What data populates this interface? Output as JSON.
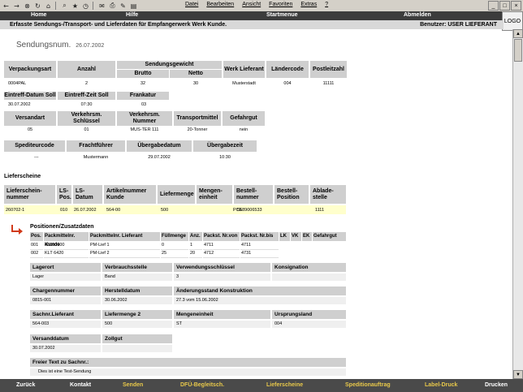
{
  "browser": {
    "menu": [
      "Datei",
      "Bearbeiten",
      "Ansicht",
      "Favoriten",
      "Extras",
      "?"
    ]
  },
  "nav": {
    "home": "Home",
    "help": "Hilfe",
    "start": "Startmenue",
    "logout": "Abmelden"
  },
  "logo": "LOGO",
  "subbar": {
    "title": "Erfasste Sendungs-/Transport- und Lieferdaten für Empfangerwerk Werk Kunde.",
    "user": "Benutzer: USER LIEFERANT"
  },
  "page": {
    "title": "Sendungsnum.",
    "date": "26.07.2002"
  },
  "sendung": {
    "headers": [
      "Verpackungsart",
      "Anzahl",
      "Sendungsgewicht",
      "Brutto",
      "Netto",
      "Werk Lieferant",
      "Ländercode",
      "Postleitzahl"
    ],
    "values": [
      "0004PAL",
      "2",
      "32",
      "30",
      "Musterstadt",
      "004",
      "11111"
    ]
  },
  "eintreff": {
    "headers": [
      "Eintreff-Datum Soll",
      "Eintreff-Zeit Soll",
      "Frankatur"
    ],
    "values": [
      "30.07.2002",
      "07:30",
      "03"
    ]
  },
  "versand": {
    "headers": [
      "Versandart",
      "Verkehrsm. Schlüssel",
      "Verkehrsm. Nummer",
      "Transportmittel",
      "Gefahrgut"
    ],
    "values": [
      "05",
      "01",
      "MUS-TER 111",
      "20-Tonner",
      "nein"
    ]
  },
  "spediteur": {
    "headers": [
      "Spediteurcode",
      "Frachtführer",
      "Übergabedatum",
      "Übergabezeit"
    ],
    "values": [
      "---",
      "Mustermann",
      "29.07.2002",
      "10:30"
    ]
  },
  "lieferscheine": {
    "title": "Lieferscheine",
    "headers": [
      "Lieferschein-nummer",
      "LS-Pos.",
      "LS-Datum",
      "Artikelnummer Kunde",
      "Liefermenge",
      "Mengen-einheit",
      "Bestell-nummer",
      "Bestell-Position",
      "Ablade-stelle"
    ],
    "row": [
      "260702-1",
      "010",
      "26.07.2002",
      "564-00",
      "500",
      "PCE",
      "5589006533",
      "",
      "1111"
    ]
  },
  "positionen": {
    "title": "Positionen/Zusatzdaten",
    "headers": [
      "Pos.",
      "Packmittelnr. Kunde",
      "Packmittelnr. Lieferant",
      "Füllmenge",
      "Anz.",
      "Packst. Nr.von",
      "Packst. Nr.bis",
      "LK",
      "VK",
      "EK",
      "Gefahrgut"
    ],
    "rows": [
      [
        "001",
        "48000000",
        "PM-Lief 1",
        "0",
        "1",
        "4711",
        "4711",
        "",
        "",
        "",
        ""
      ],
      [
        "002",
        "KLT 6420",
        "PM-Lief 2",
        "25",
        "20",
        "4712",
        "4731",
        "",
        "",
        "",
        ""
      ]
    ]
  },
  "details": {
    "lagerort": {
      "label": "Lagerort",
      "value": "Lager"
    },
    "verbrauchsstelle": {
      "label": "Verbrauchsstelle",
      "value": "Band"
    },
    "verwendungsschluessel": {
      "label": "Verwendungsschlüssel",
      "value": "3"
    },
    "konsignation": {
      "label": "Konsignation",
      "value": ""
    },
    "chargennummer": {
      "label": "Chargennummer",
      "value": "0815-001"
    },
    "herstelldatum": {
      "label": "Herstelldatum",
      "value": "30.06.2002"
    },
    "aenderungsstand": {
      "label": "Änderungsstand Konstruktion",
      "value": "27.3 vom 15.06.2002"
    },
    "sachnr": {
      "label": "Sachnr.Lieferant",
      "value": "564-003"
    },
    "liefermenge2": {
      "label": "Liefermenge 2",
      "value": "500"
    },
    "mengeneinheit": {
      "label": "Mengeneinheit",
      "value": "ST"
    },
    "ursprungsland": {
      "label": "Ursprungsland",
      "value": "004"
    },
    "versanddatum": {
      "label": "Versanddatum",
      "value": "30.07.2002"
    },
    "zollgut": {
      "label": "Zollgut",
      "value": ""
    },
    "freitext": {
      "label": "Freier Text zu Sachnr.:",
      "value": "Dies ist eine Test-Sendung"
    }
  },
  "footer": [
    "Zurück",
    "Kontakt",
    "Senden",
    "DFÜ-Begleitsch.",
    "Lieferscheine",
    "Speditionauftrag",
    "Label-Druck",
    "Drucken"
  ]
}
